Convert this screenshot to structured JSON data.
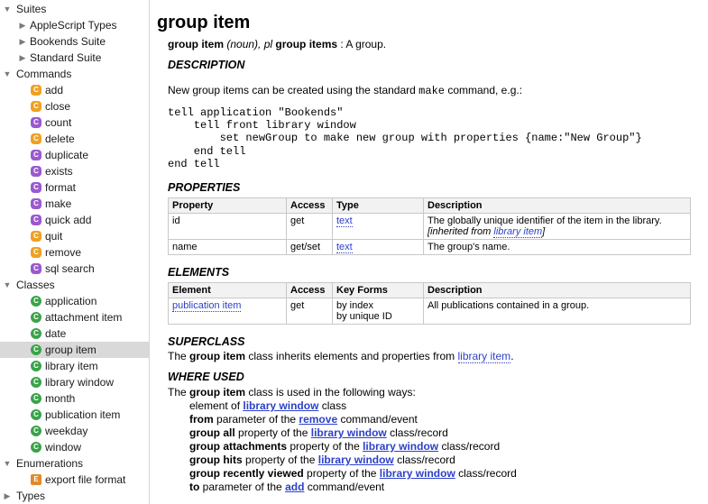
{
  "sidebar": {
    "suites": {
      "label": "Suites",
      "items": [
        "AppleScript Types",
        "Bookends Suite",
        "Standard Suite"
      ]
    },
    "commands": {
      "label": "Commands",
      "items": [
        {
          "label": "add",
          "kind": "c"
        },
        {
          "label": "close",
          "kind": "c"
        },
        {
          "label": "count",
          "kind": "p"
        },
        {
          "label": "delete",
          "kind": "c"
        },
        {
          "label": "duplicate",
          "kind": "p"
        },
        {
          "label": "exists",
          "kind": "p"
        },
        {
          "label": "format",
          "kind": "p"
        },
        {
          "label": "make",
          "kind": "p"
        },
        {
          "label": "quick add",
          "kind": "p"
        },
        {
          "label": "quit",
          "kind": "c"
        },
        {
          "label": "remove",
          "kind": "c"
        },
        {
          "label": "sql search",
          "kind": "p"
        }
      ]
    },
    "classes": {
      "label": "Classes",
      "items": [
        "application",
        "attachment item",
        "date",
        "group item",
        "library item",
        "library window",
        "month",
        "publication item",
        "weekday",
        "window"
      ],
      "selected": "group item"
    },
    "enumerations": {
      "label": "Enumerations",
      "items": [
        "export file format"
      ]
    },
    "types": {
      "label": "Types"
    },
    "icons": {
      "command_badge_glyph": "C",
      "class_badge_glyph": "C",
      "enum_badge_glyph": "E",
      "disclosure_open": "▼",
      "disclosure_closed": "▶"
    },
    "colors": {
      "command_orange": "#f0a020",
      "command_purple": "#9b59d0",
      "class_green": "#3aa34a",
      "enum_orange": "#e08a2a",
      "selection": "#d9d9d9"
    }
  },
  "main": {
    "title": "group item",
    "subtitle": {
      "name": "group item",
      "part": "(noun), pl",
      "plural": "group items",
      "desc": ": A group."
    },
    "description": {
      "heading": "DESCRIPTION",
      "text_before": "New group items can be created using the standard",
      "code_word": "make",
      "text_after": "command, e.g.:",
      "code": "tell application \"Bookends\"\n    tell front library window\n        set newGroup to make new group with properties {name:\"New Group\"}\n    end tell\nend tell"
    },
    "properties": {
      "heading": "PROPERTIES",
      "columns": [
        "Property",
        "Access",
        "Type",
        "Description"
      ],
      "rows": [
        {
          "property": "id",
          "access": "get",
          "type": "text",
          "description": "The globally unique identifier of the item in the library.",
          "inherited_prefix": "[inherited from",
          "inherited_link": "library item",
          "inherited_suffix": "]"
        },
        {
          "property": "name",
          "access": "get/set",
          "type": "text",
          "description": "The group's name."
        }
      ]
    },
    "elements": {
      "heading": "ELEMENTS",
      "columns": [
        "Element",
        "Access",
        "Key Forms",
        "Description"
      ],
      "rows": [
        {
          "element": "publication item",
          "access": "get",
          "key_form_1": "by index",
          "key_form_2": "by unique ID",
          "description": "All publications contained in a group."
        }
      ]
    },
    "superclass": {
      "heading": "SUPERCLASS",
      "prefix": "The",
      "class_name": "group item",
      "middle": "class inherits elements and properties from",
      "link": "library item",
      "suffix": "."
    },
    "where_used": {
      "heading": "WHERE USED",
      "intro_prefix": "The",
      "intro_class": "group item",
      "intro_suffix": "class is used in the following ways:",
      "items": [
        {
          "lead": "",
          "leadtext": "element of",
          "link": "library window",
          "tail": "class"
        },
        {
          "lead": "from",
          "leadtext": "parameter of the",
          "link": "remove",
          "tail": "command/event"
        },
        {
          "lead": "group all",
          "leadtext": "property of the",
          "link": "library window",
          "tail": "class/record"
        },
        {
          "lead": "group attachments",
          "leadtext": "property of the",
          "link": "library window",
          "tail": "class/record"
        },
        {
          "lead": "group hits",
          "leadtext": "property of the",
          "link": "library window",
          "tail": "class/record"
        },
        {
          "lead": "group recently viewed",
          "leadtext": "property of the",
          "link": "library window",
          "tail": "class/record"
        },
        {
          "lead": "to",
          "leadtext": "parameter of the",
          "link": "add",
          "tail": "command/event"
        }
      ]
    },
    "link_color": "#2d41c7"
  }
}
